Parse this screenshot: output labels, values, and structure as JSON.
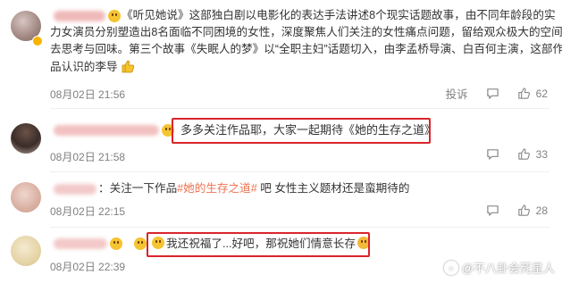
{
  "comments": [
    {
      "text_a": "《听见她说》这部独白剧以电影化的表达手法讲述8个现实话题故事，由不同年龄段的实",
      "text_b": "力女演员分别塑造出8名面临不同困境的女性，深度聚焦人们关注的女性痛点问题，留给观众极大的空间",
      "text_c": "去思考与回味。第三个故事《失眠人的梦》以“全职主妇”话题切入，由李孟桥导演、白百何主演，这部作",
      "text_d": "品认识的李导",
      "time": "08月02日 21:56",
      "report_label": "投诉",
      "like_count": "62"
    },
    {
      "text": "多多关注作品耶，大家一起期待《她的生存之道》",
      "time": "08月02日 21:58",
      "like_count": "33"
    },
    {
      "prefix": "：关注一下作品",
      "tag": "#她的生存之道#",
      "suffix": " 吧 女性主义题材还是蛮期待的",
      "time": "08月02日 22:15",
      "like_count": "28"
    },
    {
      "text": "我还祝福了...好吧，那祝她们情意长存",
      "time": "08月02日 22:39"
    }
  ],
  "watermark": {
    "text": "@不八卦会死星人"
  },
  "colors": {
    "highlight_border": "#d9252b",
    "tag": "#eb7350",
    "meta": "#808080"
  },
  "icons": [
    "comment-icon",
    "like-icon",
    "emoji-icon",
    "verified-badge-icon",
    "thumbs-up-emoji-icon"
  ]
}
